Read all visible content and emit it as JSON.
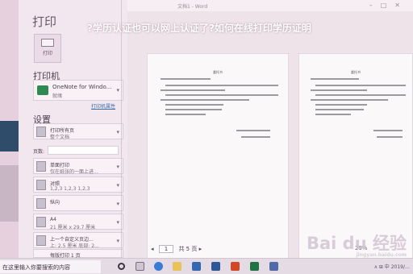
{
  "overlay": {
    "headline": "?学历认证也可以网上认证了?如何在线打印学历证明　　"
  },
  "window": {
    "title": "文档1 - Word"
  },
  "panel": {
    "title": "打印",
    "print_button_label": "打印",
    "printer_heading": "打印机",
    "printer_name": "OneNote for Windo...",
    "printer_status": "就绪",
    "printer_props_link": "打印机属性",
    "settings_heading": "设置",
    "pages_label": "页数:",
    "settings": [
      {
        "line1": "打印所有页",
        "line2": "整个文档"
      },
      {
        "line1": "单面打印",
        "line2": "仅在纸张的一面上进..."
      },
      {
        "line1": "对照",
        "line2": "1,2,3    1,2,3    1,2,3"
      },
      {
        "line1": "纵向",
        "line2": ""
      },
      {
        "line1": "A4",
        "line2": "21 厘米 x 29.7 厘米"
      },
      {
        "line1": "上一个自定义页边...",
        "line2": "上: 2.5 厘米 底部: 2..."
      },
      {
        "line1": "每版打印 1 页",
        "line2": ""
      }
    ]
  },
  "preview": {
    "pager_current": "1",
    "pager_text": "共 5 页",
    "zoom_text": "29%",
    "page_title": "委托书"
  },
  "watermark": {
    "text": "Bai du 经验",
    "sub": "jingyan.baidu.com"
  },
  "taskbar": {
    "search_text": "在这里输入你要搜索的内容",
    "tray_text": "∧  ⊞  中  2019/…"
  },
  "colors": {
    "accent_dark": "#2f4d6b",
    "link": "#3b6da6",
    "panel_bg": "#f3e7ef",
    "overlay_tint": "#f6eef3"
  },
  "icons": [
    "printer-icon",
    "onenote-icon",
    "page-icon",
    "start-icon",
    "edge-icon",
    "word-icon"
  ]
}
